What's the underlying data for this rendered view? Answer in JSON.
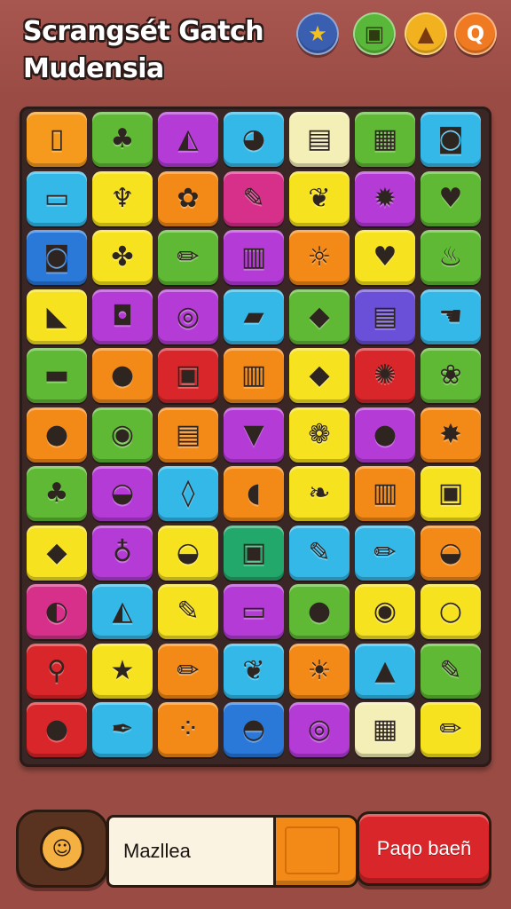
{
  "header": {
    "title_line1": "Scrangsét Gatch",
    "title_line2": "Mudensia",
    "icons": [
      {
        "name": "star-icon",
        "color": "#3b5fb0",
        "glyph": "★",
        "glyph_color": "#f4c020"
      },
      {
        "name": "card-icon",
        "color": "#59b83a",
        "glyph": "▣",
        "glyph_color": "#2e3a10"
      },
      {
        "name": "campfire-icon",
        "color": "#f2b11e",
        "glyph": "▲",
        "glyph_color": "#7a3a10"
      },
      {
        "name": "search-icon",
        "color": "#f07a22",
        "glyph": "Q",
        "glyph_color": "#ffffff"
      }
    ]
  },
  "board": {
    "rows": [
      [
        {
          "bg": "#f59a1c",
          "icon": "cup-icon",
          "glyph": "▯"
        },
        {
          "bg": "#5fb935",
          "icon": "plant-pot-icon",
          "glyph": "♣"
        },
        {
          "bg": "#b43bd6",
          "icon": "cake-icon",
          "glyph": "◭"
        },
        {
          "bg": "#34b8e8",
          "icon": "speech-bubble-icon",
          "glyph": "◕"
        },
        {
          "bg": "#f4efb6",
          "icon": "radio-icon",
          "glyph": "▤"
        },
        {
          "bg": "#5fb935",
          "icon": "gift-box-icon",
          "glyph": "▦"
        },
        {
          "bg": "#34b8e8",
          "icon": "camera-icon",
          "glyph": "◙"
        }
      ],
      [
        {
          "bg": "#34b8e8",
          "icon": "phone-icon",
          "glyph": "▭"
        },
        {
          "bg": "#f6e21e",
          "icon": "palm-tree-icon",
          "glyph": "♆"
        },
        {
          "bg": "#f38a18",
          "icon": "flower-icon",
          "glyph": "✿"
        },
        {
          "bg": "#d6308a",
          "icon": "pen-icon",
          "glyph": "✎"
        },
        {
          "bg": "#f6e21e",
          "icon": "shell-icon",
          "glyph": "❦"
        },
        {
          "bg": "#b43bd6",
          "icon": "sun-flower-icon",
          "glyph": "✹"
        },
        {
          "bg": "#5fb935",
          "icon": "acorn-icon",
          "glyph": "♥"
        }
      ],
      [
        {
          "bg": "#2a78d8",
          "icon": "camera-icon",
          "glyph": "◙"
        },
        {
          "bg": "#f6e21e",
          "icon": "puzzle-icon",
          "glyph": "✤"
        },
        {
          "bg": "#5fb935",
          "icon": "pencil-icon",
          "glyph": "✏"
        },
        {
          "bg": "#b43bd6",
          "icon": "cash-register-icon",
          "glyph": "▥"
        },
        {
          "bg": "#f38a18",
          "icon": "lamp-icon",
          "glyph": "☼"
        },
        {
          "bg": "#f6e21e",
          "icon": "heart-icon",
          "glyph": "♥"
        },
        {
          "bg": "#5fb935",
          "icon": "cupcake-icon",
          "glyph": "♨"
        }
      ],
      [
        {
          "bg": "#f6e21e",
          "icon": "carrot-icon",
          "glyph": "◣"
        },
        {
          "bg": "#b43bd6",
          "icon": "candy-icon",
          "glyph": "◘"
        },
        {
          "bg": "#b43bd6",
          "icon": "ring-icon",
          "glyph": "◎"
        },
        {
          "bg": "#34b8e8",
          "icon": "picture-icon",
          "glyph": "▰"
        },
        {
          "bg": "#5fb935",
          "icon": "anvil-icon",
          "glyph": "◆"
        },
        {
          "bg": "#6a4fd8",
          "icon": "keyboard-icon",
          "glyph": "▤"
        },
        {
          "bg": "#34b8e8",
          "icon": "glove-icon",
          "glyph": "☚"
        }
      ],
      [
        {
          "bg": "#5fb935",
          "icon": "book-icon",
          "glyph": "▬"
        },
        {
          "bg": "#f38a18",
          "icon": "orange-icon",
          "glyph": "●"
        },
        {
          "bg": "#d8262a",
          "icon": "wallet-icon",
          "glyph": "▣"
        },
        {
          "bg": "#f38a18",
          "icon": "building-icon",
          "glyph": "▥"
        },
        {
          "bg": "#f6e21e",
          "icon": "bird-icon",
          "glyph": "◆"
        },
        {
          "bg": "#d8262a",
          "icon": "splat-icon",
          "glyph": "✺"
        },
        {
          "bg": "#5fb935",
          "icon": "twig-icon",
          "glyph": "❀"
        }
      ],
      [
        {
          "bg": "#f38a18",
          "icon": "snail-icon",
          "glyph": "●"
        },
        {
          "bg": "#5fb935",
          "icon": "cookie-icon",
          "glyph": "◉"
        },
        {
          "bg": "#f38a18",
          "icon": "monitor-icon",
          "glyph": "▤"
        },
        {
          "bg": "#b43bd6",
          "icon": "basket-icon",
          "glyph": "▼"
        },
        {
          "bg": "#f6e21e",
          "icon": "rose-icon",
          "glyph": "❁"
        },
        {
          "bg": "#b43bd6",
          "icon": "stone-icon",
          "glyph": "●"
        },
        {
          "bg": "#f38a18",
          "icon": "burst-icon",
          "glyph": "✸"
        }
      ],
      [
        {
          "bg": "#5fb935",
          "icon": "potted-plant-icon",
          "glyph": "♣"
        },
        {
          "bg": "#b43bd6",
          "icon": "bowl-icon",
          "glyph": "◒"
        },
        {
          "bg": "#34b8e8",
          "icon": "flask-icon",
          "glyph": "◊"
        },
        {
          "bg": "#f38a18",
          "icon": "shoe-icon",
          "glyph": "◖"
        },
        {
          "bg": "#f6e21e",
          "icon": "pepper-icon",
          "glyph": "❧"
        },
        {
          "bg": "#f38a18",
          "icon": "bread-icon",
          "glyph": "▥"
        },
        {
          "bg": "#f6e21e",
          "icon": "radio-icon",
          "glyph": "▣"
        }
      ],
      [
        {
          "bg": "#f6e21e",
          "icon": "cheese-icon",
          "glyph": "◆"
        },
        {
          "bg": "#b43bd6",
          "icon": "lollipop-icon",
          "glyph": "♁"
        },
        {
          "bg": "#f6e21e",
          "icon": "salad-bowl-icon",
          "glyph": "◒"
        },
        {
          "bg": "#22a86a",
          "icon": "camera-icon",
          "glyph": "▣"
        },
        {
          "bg": "#34b8e8",
          "icon": "brush-icon",
          "glyph": "✎"
        },
        {
          "bg": "#34b8e8",
          "icon": "marker-icon",
          "glyph": "✏"
        },
        {
          "bg": "#f38a18",
          "icon": "fruit-bowl-icon",
          "glyph": "◒"
        }
      ],
      [
        {
          "bg": "#d6308a",
          "icon": "marble-icon",
          "glyph": "◐"
        },
        {
          "bg": "#34b8e8",
          "icon": "pizza-icon",
          "glyph": "◭"
        },
        {
          "bg": "#f6e21e",
          "icon": "paintbrush-icon",
          "glyph": "✎"
        },
        {
          "bg": "#b43bd6",
          "icon": "briefcase-icon",
          "glyph": "▭"
        },
        {
          "bg": "#5fb935",
          "icon": "apple-icon",
          "glyph": "●"
        },
        {
          "bg": "#f6e21e",
          "icon": "yarn-icon",
          "glyph": "◉"
        },
        {
          "bg": "#f6e21e",
          "icon": "ring-icon",
          "glyph": "○"
        }
      ],
      [
        {
          "bg": "#d8262a",
          "icon": "magnifier-icon",
          "glyph": "⚲"
        },
        {
          "bg": "#f6e21e",
          "icon": "star-icon",
          "glyph": "★"
        },
        {
          "bg": "#f38a18",
          "icon": "pencil-icon",
          "glyph": "✏"
        },
        {
          "bg": "#34b8e8",
          "icon": "ribbon-icon",
          "glyph": "❦"
        },
        {
          "bg": "#f38a18",
          "icon": "sun-icon",
          "glyph": "☀"
        },
        {
          "bg": "#34b8e8",
          "icon": "cake-slice-icon",
          "glyph": "▲"
        },
        {
          "bg": "#5fb935",
          "icon": "crayon-icon",
          "glyph": "✎"
        }
      ],
      [
        {
          "bg": "#d8262a",
          "icon": "lime-icon",
          "glyph": "●"
        },
        {
          "bg": "#34b8e8",
          "icon": "pen-icon",
          "glyph": "✒"
        },
        {
          "bg": "#f38a18",
          "icon": "cherries-icon",
          "glyph": "⁘"
        },
        {
          "bg": "#2a78d8",
          "icon": "purse-icon",
          "glyph": "◓"
        },
        {
          "bg": "#b43bd6",
          "icon": "target-icon",
          "glyph": "◎"
        },
        {
          "bg": "#f4efb6",
          "icon": "present-icon",
          "glyph": "▦"
        },
        {
          "bg": "#f6e21e",
          "icon": "pencil-icon",
          "glyph": "✏"
        }
      ]
    ]
  },
  "footer": {
    "avatar_name": "lion-avatar-icon",
    "avatar_glyph": "☺",
    "name_field_value": "Mazllea",
    "progress_value": 1.0,
    "progress_color": "#f38a18",
    "action_button_label": "Paqo baeñ",
    "action_button_color": "#d8262a"
  }
}
